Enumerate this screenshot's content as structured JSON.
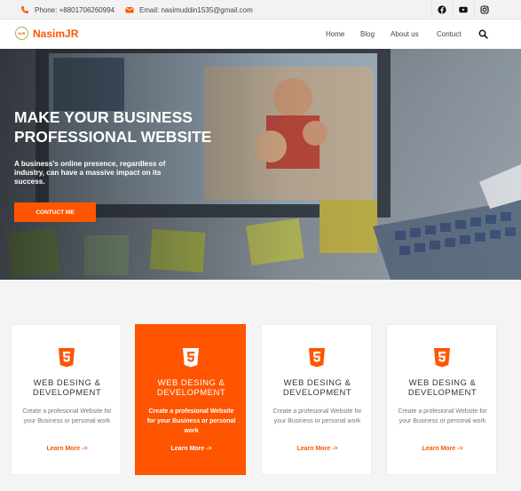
{
  "topbar": {
    "phone": "Phone: +8801706260994",
    "email": "Email: nasimuddin1535@gmail.com",
    "social_icons": [
      "facebook-icon",
      "youtube-icon",
      "instagram-icon"
    ]
  },
  "navbar": {
    "logo_badge": "NJR",
    "logo_text": "NasimJR",
    "items": [
      {
        "label": "Home"
      },
      {
        "label": "Blog"
      },
      {
        "label": "About us"
      },
      {
        "label": "Contuct"
      }
    ],
    "search_icon": "search-icon"
  },
  "hero": {
    "title": "MAKE YOUR BUSINESS PROFESSIONAL WEBSITE",
    "subtitle": "A business's online presence, regardless of industry, can have a massive impact on its success.",
    "button": "CONTUCT ME"
  },
  "services": [
    {
      "title": "WEB DESING & DEVELOPMENT",
      "text": "Create a profesional Website for your Business or personal work",
      "more": "Learn More ->",
      "active": false
    },
    {
      "title": "WEB DESING & DEVELOPMENT",
      "text": "Create a profesional Website for your Business or personal work",
      "more": "Learn More ->",
      "active": true
    },
    {
      "title": "WEB DESING & DEVELOPMENT",
      "text": "Create a profesional Website for your Business or personal work",
      "more": "Learn More ->",
      "active": false
    },
    {
      "title": "WEB DESING & DEVELOPMENT",
      "text": "Create a profesional Website for your Business or personal work",
      "more": "Learn More ->",
      "active": false
    }
  ],
  "colors": {
    "accent": "#ff5500",
    "logo_ring": "#8fbf3a",
    "topbar_bg": "#f2f2f2",
    "page_bg": "#f4f4f4"
  }
}
